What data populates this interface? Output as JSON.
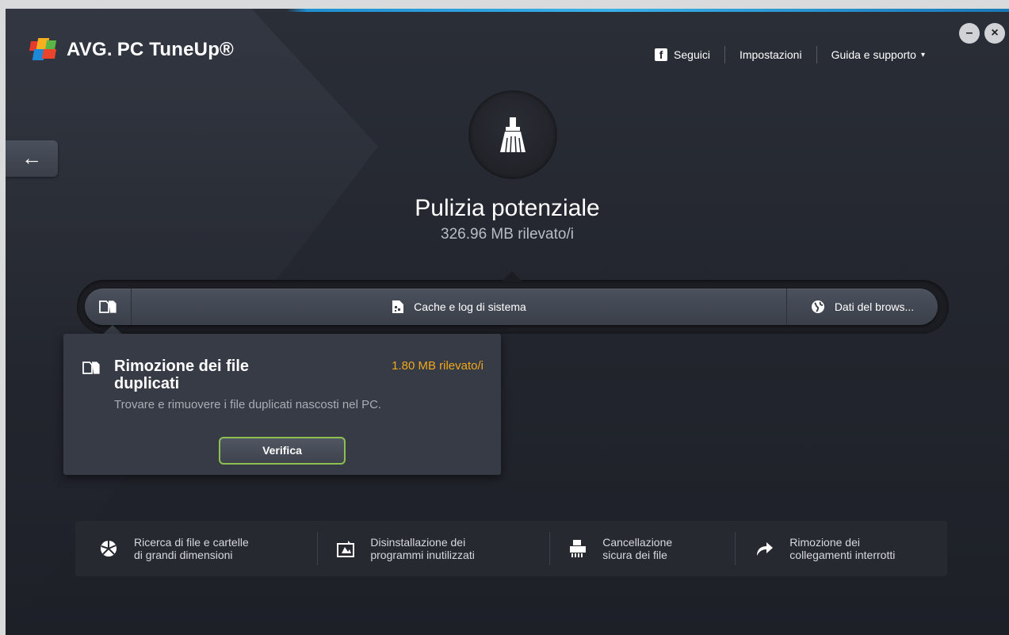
{
  "app": {
    "logo_avg": "AVG.",
    "logo_name": "PC TuneUp®"
  },
  "topnav": {
    "follow": "Seguici",
    "settings": "Impostazioni",
    "help": "Guida e supporto",
    "help_caret": "▾"
  },
  "window_controls": {
    "minimize": "–",
    "close": "×"
  },
  "back": {
    "label": "←"
  },
  "hero": {
    "title": "Pulizia potenziale",
    "subtitle": "326.96 MB rilevato/i"
  },
  "tabs": {
    "cache_label": "Cache e log di sistema",
    "browser_label": "Dati del brows..."
  },
  "popup": {
    "title": "Rimozione dei file duplicati",
    "amount": "1.80 MB rilevato/i",
    "description": "Trovare e rimuovere i file duplicati nascosti nel PC.",
    "button": "Verifica"
  },
  "tools": [
    {
      "line1": "Ricerca di file e cartelle",
      "line2": "di grandi dimensioni",
      "icon": "disk-usage-icon"
    },
    {
      "line1": "Disinstallazione dei",
      "line2": "programmi inutilizzati",
      "icon": "uninstall-icon"
    },
    {
      "line1": "Cancellazione",
      "line2": "sicura dei file",
      "icon": "shredder-icon"
    },
    {
      "line1": "Rimozione dei",
      "line2": "collegamenti interrotti",
      "icon": "broken-link-icon"
    }
  ],
  "colors": {
    "accent_green": "#8cc152",
    "amount_orange": "#f0a81c",
    "top_line_blue": "#3ab0e8"
  }
}
